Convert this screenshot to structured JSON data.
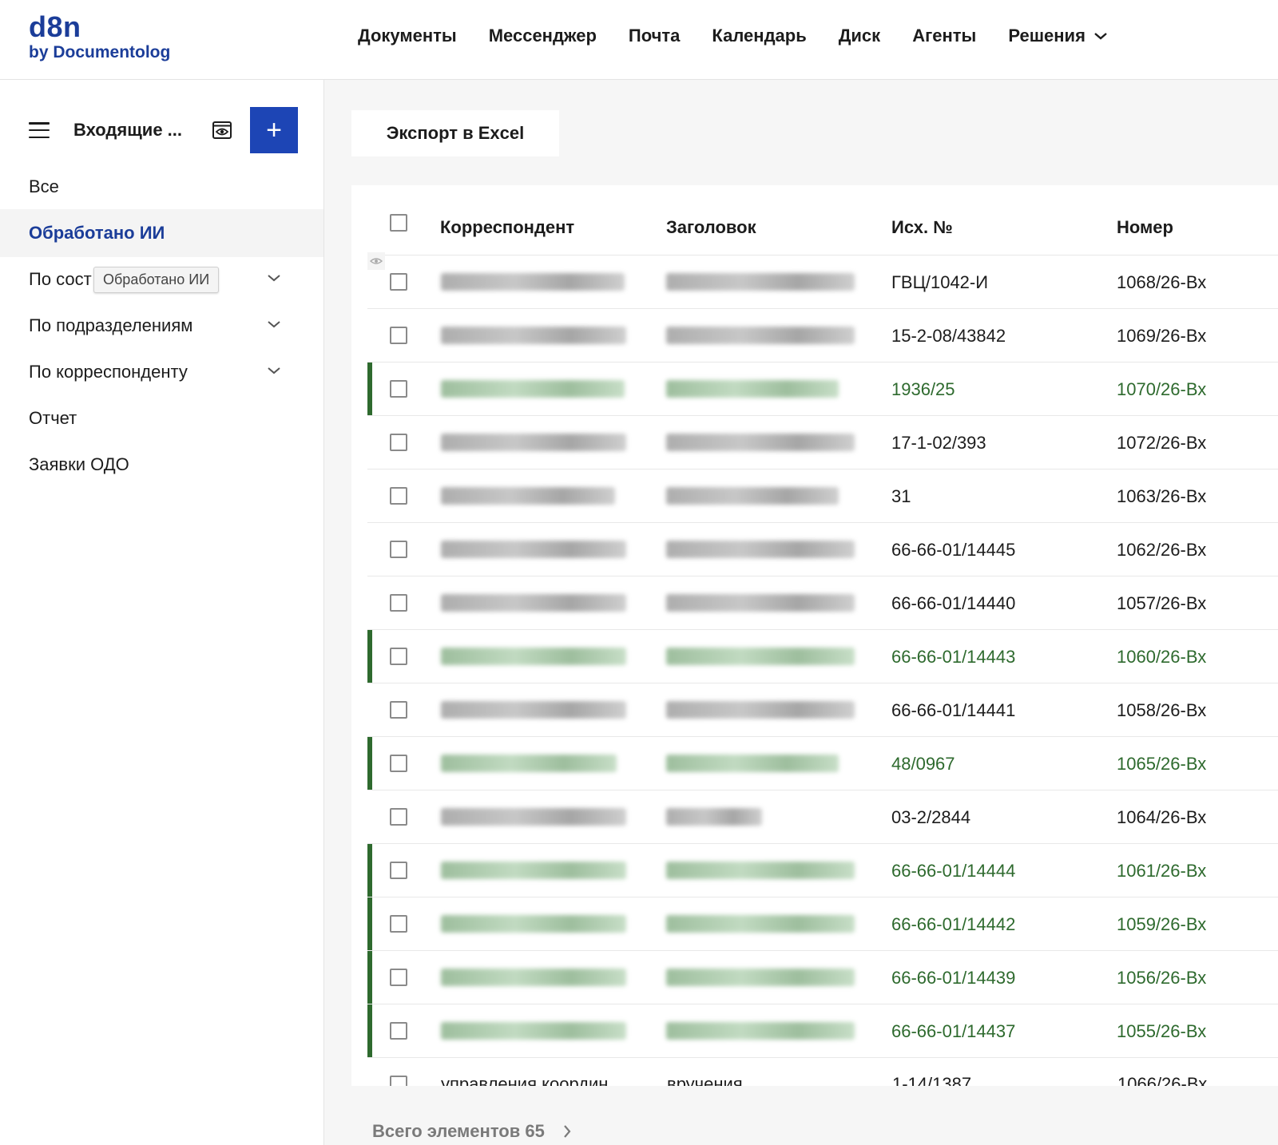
{
  "brand": {
    "logo_main": "d8n",
    "logo_sub": "by Documentolog"
  },
  "topnav": [
    {
      "label": "Документы"
    },
    {
      "label": "Мессенджер"
    },
    {
      "label": "Почта"
    },
    {
      "label": "Календарь"
    },
    {
      "label": "Диск"
    },
    {
      "label": "Агенты"
    },
    {
      "label": "Решения",
      "has_dropdown": true
    }
  ],
  "sidebar": {
    "title": "Входящие ...",
    "add_label": "+",
    "items": [
      {
        "label": "Все",
        "active": false
      },
      {
        "label": "Обработано ИИ",
        "active": true
      },
      {
        "label": "По сост",
        "expandable": true
      },
      {
        "label": "По подразделениям",
        "expandable": true
      },
      {
        "label": "По корреспонденту",
        "expandable": true
      },
      {
        "label": "Отчет"
      },
      {
        "label": "Заявки ОДО"
      }
    ],
    "tooltip": "Обработано ИИ"
  },
  "toolbar": {
    "export_label": "Экспорт в Excel"
  },
  "table": {
    "columns": [
      "Корреспондент",
      "Заголовок",
      "Исх. №",
      "Номер"
    ],
    "rows": [
      {
        "out_no": "ГВЦ/1042-И",
        "number": "1068/26-Вх",
        "processed": false
      },
      {
        "out_no": "15-2-08/43842",
        "number": "1069/26-Вх",
        "processed": false
      },
      {
        "out_no": "1936/25",
        "number": "1070/26-Вх",
        "processed": true
      },
      {
        "out_no": "17-1-02/393",
        "number": "1072/26-Вх",
        "processed": false
      },
      {
        "out_no": "31",
        "number": "1063/26-Вх",
        "processed": false
      },
      {
        "out_no": "66-66-01/14445",
        "number": "1062/26-Вх",
        "processed": false
      },
      {
        "out_no": "66-66-01/14440",
        "number": "1057/26-Вх",
        "processed": false
      },
      {
        "out_no": "66-66-01/14443",
        "number": "1060/26-Вх",
        "processed": true
      },
      {
        "out_no": "66-66-01/14441",
        "number": "1058/26-Вх",
        "processed": false
      },
      {
        "out_no": "48/0967",
        "number": "1065/26-Вх",
        "processed": true
      },
      {
        "out_no": "03-2/2844",
        "number": "1064/26-Вх",
        "processed": false
      },
      {
        "out_no": "66-66-01/14444",
        "number": "1061/26-Вх",
        "processed": true
      },
      {
        "out_no": "66-66-01/14442",
        "number": "1059/26-Вх",
        "processed": true
      },
      {
        "out_no": "66-66-01/14439",
        "number": "1056/26-Вх",
        "processed": true
      },
      {
        "out_no": "66-66-01/14437",
        "number": "1055/26-Вх",
        "processed": true
      }
    ],
    "partial_row": {
      "correspondent": "управления координ",
      "title": "вручения",
      "out_no": "1-14/1387",
      "number": "1066/26-Вх"
    }
  },
  "footer": {
    "total_label": "Всего элементов 65"
  },
  "colors": {
    "accent": "#1d45b5",
    "brand": "#1b3d99",
    "processed": "#2e6a2e"
  }
}
